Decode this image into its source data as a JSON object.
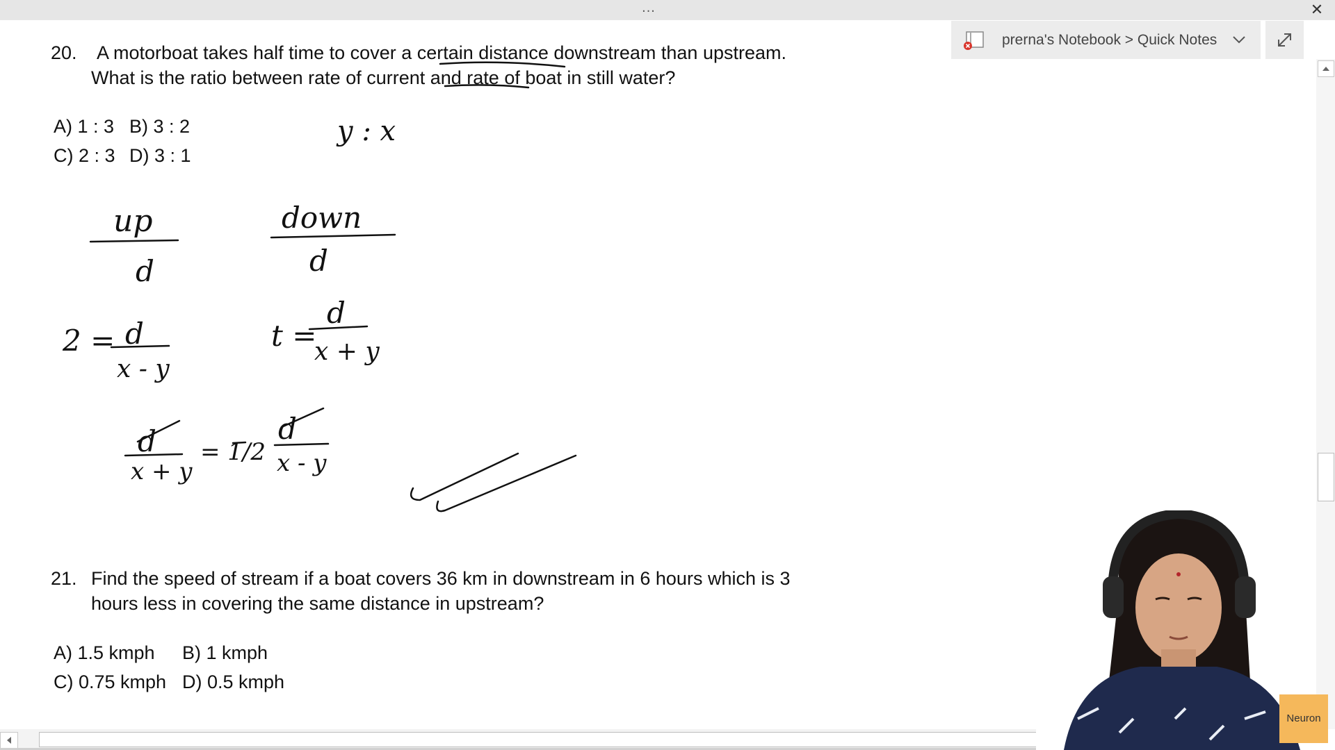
{
  "window": {
    "menu_dots": "...",
    "close_glyph": "✕"
  },
  "notebook": {
    "path": "prerna's Notebook > Quick Notes"
  },
  "questions": [
    {
      "number": "20.",
      "line1": "A motorboat takes half time to cover a certain distance downstream than upstream.",
      "line2": "What is the ratio between rate of current and rate of boat in still water?",
      "options": [
        "A) 1 : 3",
        "B) 3 : 2",
        "C) 2 : 3",
        "D) 3 : 1"
      ]
    },
    {
      "number": "21.",
      "line1": "Find the speed of stream if a boat covers 36 km in downstream in 6 hours which is 3",
      "line2": "hours less in covering the same distance in upstream?",
      "options": [
        "A) 1.5 kmph",
        "B) 1 kmph",
        "C) 0.75 kmph",
        "D) 0.5 kmph"
      ]
    }
  ],
  "handwriting": {
    "ratio": "y : x",
    "up": "up",
    "down": "down",
    "d": "d",
    "eq_left_var": "2 =",
    "eq_left_den": "x - y",
    "eq_right_var": "t =",
    "eq_right_den": "x + y",
    "final_left_den": "x + y",
    "final_half": "= 1/2",
    "final_right_den": "x - y"
  },
  "brand": {
    "logo_text": "Neuron"
  },
  "icons": {
    "notebook": "notebook-icon",
    "chevron": "chevron-down-icon",
    "expand": "expand-icon",
    "close": "close-icon",
    "scroll_up": "arrow-up-icon",
    "scroll_left": "arrow-left-icon"
  }
}
